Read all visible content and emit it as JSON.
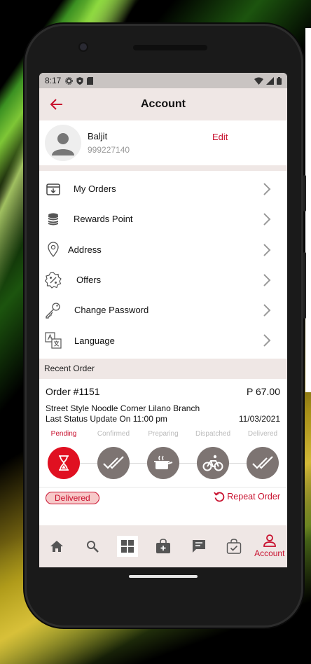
{
  "status_bar": {
    "time": "8:17"
  },
  "app_bar": {
    "title": "Account"
  },
  "profile": {
    "name": "Baljit",
    "phone": "999227140",
    "edit_label": "Edit"
  },
  "menu": [
    {
      "label": "My Orders",
      "icon": "orders-box-icon"
    },
    {
      "label": "Rewards Point",
      "icon": "coins-stack-icon"
    },
    {
      "label": "Address",
      "icon": "location-pin-icon"
    },
    {
      "label": "Offers",
      "icon": "percent-badge-icon"
    },
    {
      "label": "Change Password",
      "icon": "key-icon"
    },
    {
      "label": "Language",
      "icon": "translate-icon"
    }
  ],
  "recent_order": {
    "section_title": "Recent Order",
    "order_number": "Order #1151",
    "price": "P 67.00",
    "shop": "Street Style Noodle Corner Lilano Branch",
    "last_update": "Last Status Update On 11:00 pm",
    "date": "11/03/2021",
    "steps": [
      "Pending",
      "Confirmed",
      "Preparing",
      "Dispatched",
      "Delivered"
    ],
    "active_step": 0,
    "status_badge": "Delivered",
    "repeat_label": "Repeat Order"
  },
  "bottom_nav": {
    "active_label": "Account"
  },
  "colors": {
    "accent": "#c8102e",
    "step_active": "#e01021",
    "step_inactive": "#7d7472",
    "surface": "#efe7e5"
  }
}
